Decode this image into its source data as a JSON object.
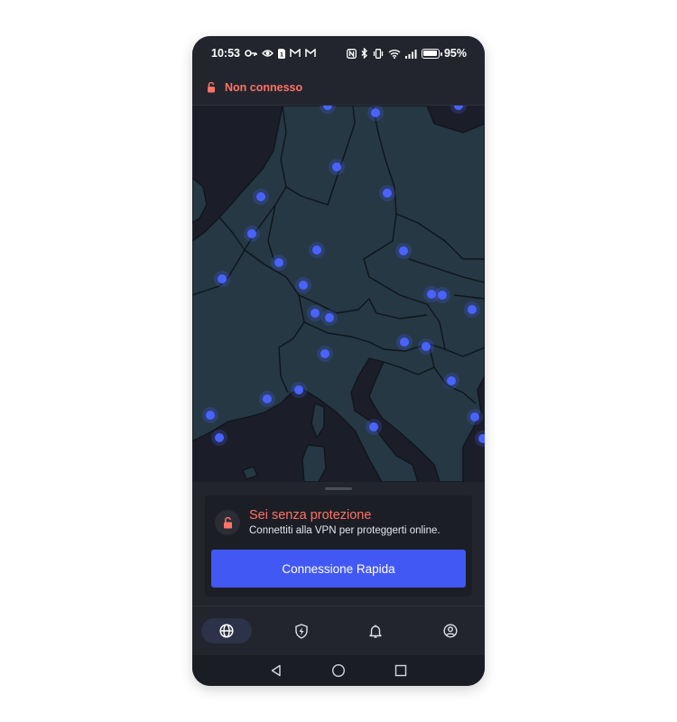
{
  "status_bar": {
    "time": "10:53",
    "battery_percent": "95%",
    "battery_level": 0.95,
    "icons": [
      "key-icon",
      "eye-icon",
      "sim-icon",
      "gmail-icon",
      "gmail-icon",
      "nfc-icon",
      "bluetooth-icon",
      "vibrate-icon",
      "wifi-icon",
      "signal-icon",
      "battery-icon"
    ]
  },
  "connection": {
    "status_label": "Non connesso",
    "status_color": "#ff7266",
    "icon": "unlocked-padlock-icon"
  },
  "map": {
    "icon": "server-location-pin",
    "pin_color": "#4a62ff",
    "server_pin_count": 28
  },
  "protection_card": {
    "title": "Sei senza protezione",
    "subtitle": "Connettiti alla VPN per proteggerti online.",
    "icon": "unlocked-padlock-icon",
    "button_label": "Connessione Rapida",
    "button_color": "#4258f5"
  },
  "tabs": [
    {
      "id": "servers",
      "icon": "globe-icon",
      "active": true
    },
    {
      "id": "protection",
      "icon": "shield-bolt-icon",
      "active": false
    },
    {
      "id": "notifications",
      "icon": "bell-icon",
      "active": false
    },
    {
      "id": "account",
      "icon": "user-circle-icon",
      "active": false
    }
  ],
  "system_nav": [
    "back-icon",
    "home-icon",
    "recents-icon"
  ]
}
